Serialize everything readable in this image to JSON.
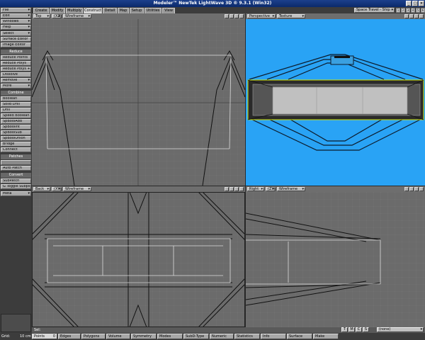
{
  "window": {
    "title": "Modeler™ NewTek LightWave 3D ® 9.3.1 (Win32)",
    "min": "_",
    "max": "□",
    "close": "×"
  },
  "sidebar": {
    "file": "File",
    "edit": "Edit",
    "windows": "Windows",
    "help": "Help",
    "select": "Select",
    "surface_editor": "Surface Editor",
    "image_editor": "Image Editor",
    "reduce_head": "Reduce",
    "reduce_points": "Reduce Points",
    "reduce_polys": "Reduce Polys",
    "reduce_polys_plus": "Reduce Polys +",
    "dissolve": "Dissolve",
    "remove": "Remove",
    "more": "More",
    "combine_head": "Combine",
    "boolean": "Boolean",
    "solid_drill": "Solid Drill",
    "drill": "Drill",
    "speed_boolean": "Speed Boolean",
    "spboolardd": "SpBoolAdd",
    "spboolint": "SpBoolInt",
    "spboolsub": "SpBoolSub",
    "spboolunion": "SpBoolUnion",
    "bridge": "Bridge",
    "connect": "Connect",
    "patches_head": "Patches",
    "auto_patch": "Auto Patch",
    "convert_head": "Convert",
    "subpatch": "SubPatch",
    "toggle_subps": "G Toggle Subps",
    "meta": "Meta"
  },
  "tabs": [
    "Create",
    "Modify",
    "Multiply",
    "Construct",
    "Detail",
    "Map",
    "Setup",
    "Utilities",
    "View"
  ],
  "active_tab": "Construct",
  "scene": "Space Travel - Ship",
  "layers": [
    "1",
    "2",
    "3",
    "4",
    "5",
    "6",
    "7",
    "8",
    "9",
    "10"
  ],
  "viewports": {
    "top": {
      "view": "Top",
      "mode": "Wireframe",
      "axis": "(XZ)"
    },
    "perspective": {
      "view": "Perspective",
      "mode": "Texture"
    },
    "back": {
      "view": "Back",
      "axis": "(XY)",
      "mode": "Wireframe"
    },
    "right": {
      "view": "Right",
      "axis": "(ZY)",
      "mode": "Wireframe"
    }
  },
  "bottom": {
    "sel": "Sel:",
    "t": "T",
    "m": "M",
    "c": "C",
    "s": "S",
    "none": "(none)"
  },
  "status": {
    "grid_label": "Grid:",
    "grid_value": "10 cm",
    "points": "Points",
    "points_count": "0",
    "edges": "Edges",
    "polygons": "Polygons",
    "volume": "Volume",
    "symmetry": "Symmetry",
    "modes": "Modes",
    "subd_type": "SubD-Type",
    "numeric": "Numeric",
    "statistics": "Statistics",
    "info": "Info",
    "surface": "Surface",
    "make": "Make"
  },
  "colors": {
    "viewport_grid": "#6b6b6b",
    "persp_bg": "#29a3f5",
    "hull": "#c0c0c0",
    "highlight": "#d8e000"
  }
}
